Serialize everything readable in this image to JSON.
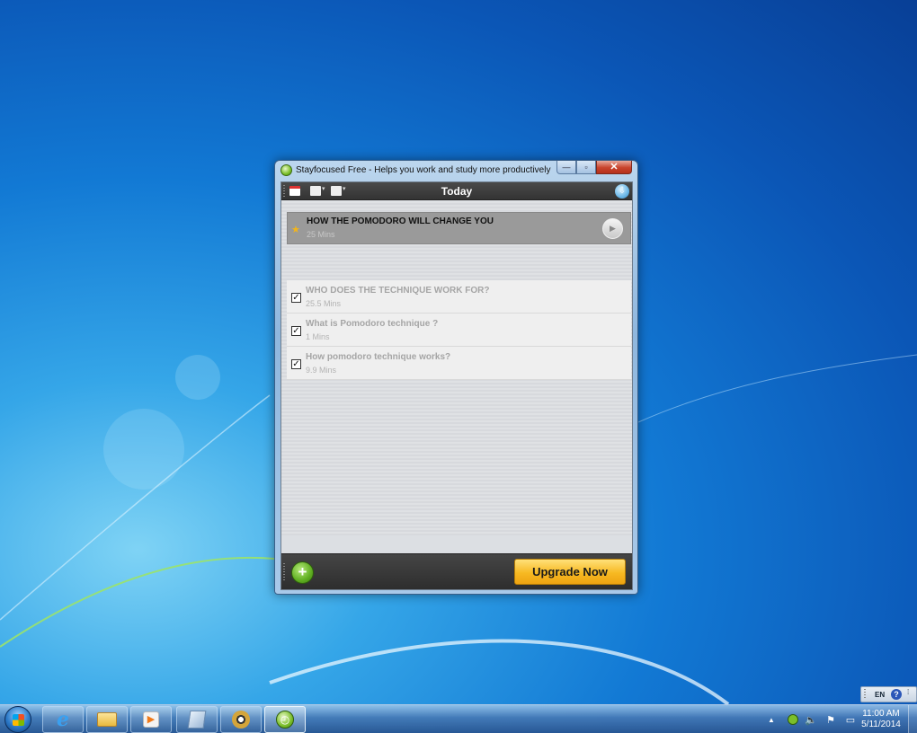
{
  "window": {
    "title": "Stayfocused Free - Helps you work and study more productively",
    "buttons": {
      "minimize": "—",
      "maximize": "▫",
      "close": "✕"
    }
  },
  "toolbar": {
    "title": "Today",
    "icons": [
      "calendar-icon",
      "list-dropdown-icon",
      "list-dropdown-icon",
      "sync-icon"
    ]
  },
  "active_task": {
    "title": "HOW THE POMODORO WILL CHANGE YOU",
    "duration": "25 Mins"
  },
  "completed_tasks": [
    {
      "title": "WHO DOES THE TECHNIQUE WORK FOR?",
      "duration": "25.5 Mins",
      "checked": true
    },
    {
      "title": "What is Pomodoro technique ?",
      "duration": "1 Mins",
      "checked": true
    },
    {
      "title": "How pomodoro technique works?",
      "duration": "9.9 Mins",
      "checked": true
    }
  ],
  "footer": {
    "add_label": "+",
    "upgrade_label": "Upgrade Now"
  },
  "language_bar": {
    "lang": "EN",
    "help": "?"
  },
  "taskbar": {
    "pinned": [
      "internet-explorer",
      "windows-explorer",
      "media-player",
      "document-app",
      "media-center",
      "stayfocused"
    ],
    "clock_time": "11:00 AM",
    "clock_date": "5/11/2014"
  },
  "colors": {
    "accent_upgrade": "#f7b922",
    "add_button": "#5fae21",
    "toolbar_bg": "#3a3a3a"
  }
}
